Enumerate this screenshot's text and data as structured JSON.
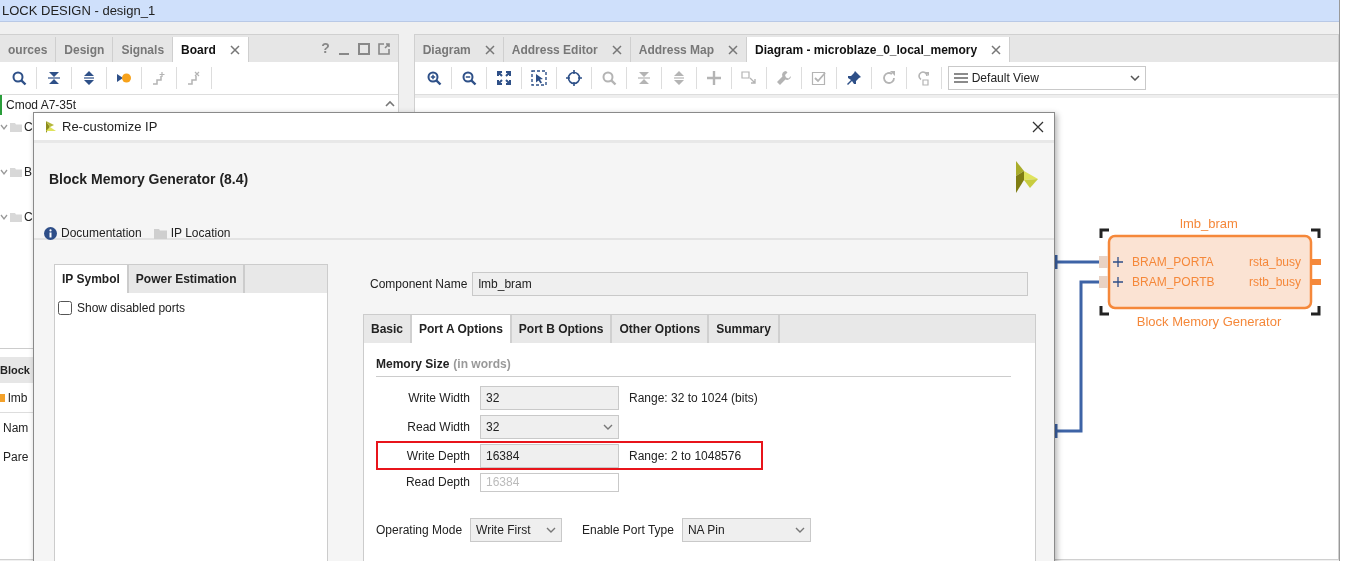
{
  "title_bar": {
    "title": "LOCK DESIGN - design_1"
  },
  "left_panel": {
    "tabs": [
      {
        "label": "ources",
        "selected": false,
        "closable": false
      },
      {
        "label": "Design",
        "selected": false,
        "closable": false
      },
      {
        "label": "Signals",
        "selected": false,
        "closable": false
      },
      {
        "label": "Board",
        "selected": true,
        "closable": true
      }
    ],
    "help": "?",
    "toolbar": [
      {
        "kind": "search",
        "disabled": false
      },
      {
        "kind": "collapse",
        "disabled": false
      },
      {
        "kind": "expand",
        "disabled": false
      },
      {
        "kind": "run",
        "disabled": false
      },
      {
        "kind": "add-step",
        "disabled": true
      },
      {
        "kind": "remove-step",
        "disabled": true
      }
    ],
    "tree": {
      "label": "Cmod A7-35t",
      "children": [
        {
          "label": "C",
          "expanded": true
        },
        {
          "label": "B",
          "expanded": true
        },
        {
          "label": "C",
          "expanded": true
        }
      ]
    },
    "properties": {
      "title": "Block",
      "item": "lmb",
      "fields": [
        "Nam",
        "Pare"
      ]
    }
  },
  "diagram_panel": {
    "tabs": [
      {
        "label": "Diagram",
        "selected": false
      },
      {
        "label": "Address Editor",
        "selected": false
      },
      {
        "label": "Address Map",
        "selected": false
      },
      {
        "label": "Diagram - microblaze_0_local_memory",
        "selected": true
      }
    ],
    "toolbar": [
      {
        "kind": "zoom-in",
        "disabled": false
      },
      {
        "kind": "zoom-out",
        "disabled": false
      },
      {
        "kind": "fit",
        "disabled": false
      },
      {
        "kind": "select-area",
        "disabled": false
      },
      {
        "kind": "target",
        "disabled": false
      },
      {
        "kind": "search",
        "disabled": true
      },
      {
        "kind": "collapse",
        "disabled": true
      },
      {
        "kind": "expand",
        "disabled": true
      },
      {
        "kind": "plus",
        "disabled": true
      },
      {
        "kind": "move",
        "disabled": true
      },
      {
        "kind": "wrench",
        "disabled": true
      },
      {
        "kind": "validate",
        "disabled": true
      },
      {
        "kind": "pin",
        "disabled": false
      },
      {
        "kind": "refresh",
        "disabled": true
      },
      {
        "kind": "regenerate",
        "disabled": true
      }
    ],
    "view_select": "Default View",
    "block": {
      "name": "lmb_bram",
      "type": "Block Memory Generator",
      "selected": true,
      "inputs": [
        "BRAM_PORTA",
        "BRAM_PORTB"
      ],
      "outputs": [
        "rsta_busy",
        "rstb_busy"
      ]
    }
  },
  "dialog": {
    "title": "Re-customize IP",
    "ip_name": "Block Memory Generator (8.4)",
    "links": [
      {
        "kind": "info",
        "label": "Documentation"
      },
      {
        "kind": "folder",
        "label": "IP Location"
      }
    ],
    "side_tabs": [
      {
        "label": "IP Symbol",
        "selected": true
      },
      {
        "label": "Power Estimation",
        "selected": false
      }
    ],
    "show_disabled_ports": {
      "label": "Show disabled ports",
      "checked": false
    },
    "component_name": {
      "label": "Component Name",
      "value": "lmb_bram"
    },
    "tabs": [
      {
        "label": "Basic",
        "selected": false
      },
      {
        "label": "Port A Options",
        "selected": true
      },
      {
        "label": "Port B Options",
        "selected": false
      },
      {
        "label": "Other Options",
        "selected": false
      },
      {
        "label": "Summary",
        "selected": false
      }
    ],
    "section": {
      "title": "Memory Size",
      "note": "(in words)"
    },
    "fields": [
      {
        "label": "Write Width",
        "kind": "text",
        "value": "32",
        "range": "Range: 32 to 1024 (bits)",
        "highlighted": false
      },
      {
        "label": "Read Width",
        "kind": "select",
        "value": "32",
        "highlighted": false
      },
      {
        "label": "Write Depth",
        "kind": "text",
        "value": "16384",
        "range": "Range: 2 to 1048576",
        "highlighted": true
      },
      {
        "label": "Read Depth",
        "kind": "readonly",
        "value": "16384",
        "highlighted": false
      }
    ],
    "bottom": [
      {
        "label": "Operating Mode",
        "value": "Write First"
      },
      {
        "label": "Enable Port Type",
        "value": "NA Pin"
      }
    ]
  }
}
